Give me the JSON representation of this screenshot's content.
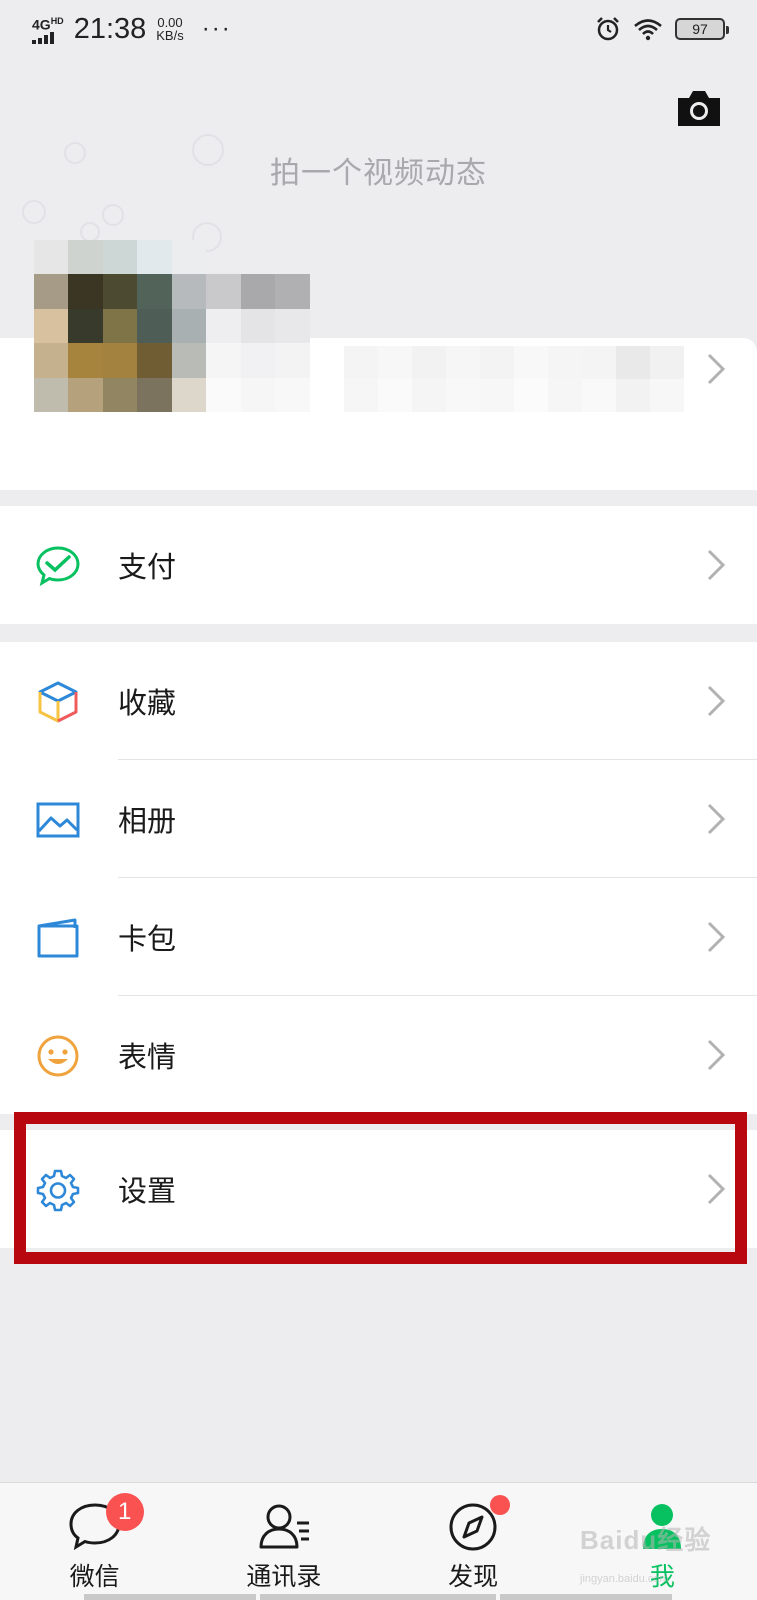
{
  "status_bar": {
    "network": "4G",
    "network_sup": "HD",
    "time": "21:38",
    "speed_value": "0.00",
    "speed_unit": "KB/s",
    "more": "···",
    "battery": "97",
    "icons": [
      "alarm-icon",
      "wifi-icon",
      "battery-icon"
    ]
  },
  "header": {
    "camera_icon": "camera-icon",
    "video_prompt": "拍一个视频动态"
  },
  "profile": {
    "avatar": "pixelated",
    "chevron": "chevron-right-icon"
  },
  "menu": {
    "pay": {
      "label": "支付",
      "icon": "wechat-pay-icon",
      "color": "#07c160"
    },
    "favorites": {
      "label": "收藏",
      "icon": "cube-icon"
    },
    "album": {
      "label": "相册",
      "icon": "photo-icon",
      "color": "#2d88d8"
    },
    "cards": {
      "label": "卡包",
      "icon": "wallet-icon",
      "color": "#2d88d8"
    },
    "stickers": {
      "label": "表情",
      "icon": "smiley-icon",
      "color": "#f0a33c"
    },
    "settings": {
      "label": "设置",
      "icon": "gear-icon",
      "color": "#2d88d8"
    }
  },
  "highlight": {
    "color": "#b8070f",
    "target": "设置"
  },
  "tabbar": {
    "tabs": [
      {
        "label": "微信",
        "icon": "chat-icon",
        "badge": "1"
      },
      {
        "label": "通讯录",
        "icon": "contacts-icon"
      },
      {
        "label": "发现",
        "icon": "compass-icon",
        "dot": true
      },
      {
        "label": "我",
        "icon": "person-icon",
        "active": true
      }
    ],
    "active_color": "#07c160"
  },
  "watermark": {
    "text": "Baidu经验",
    "sub": "jingyan.baidu.com"
  }
}
